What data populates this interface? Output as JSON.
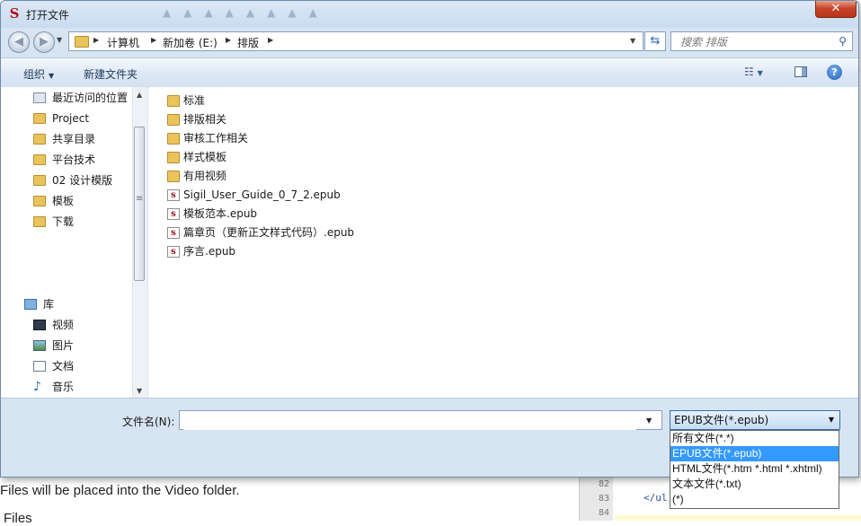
{
  "window": {
    "title": "打开文件",
    "close_label": "✕"
  },
  "nav": {
    "back_icon": "◀",
    "forward_icon": "▶",
    "breadcrumb": [
      "计算机",
      "新加卷 (E:)",
      "排版"
    ],
    "search_placeholder": "搜索 排版"
  },
  "toolbar": {
    "organize_label": "组织",
    "new_folder_label": "新建文件夹"
  },
  "sidebar": {
    "favorites": [
      {
        "label": "最近访问的位置",
        "icon": "recent-places-icon"
      },
      {
        "label": "Project",
        "icon": "folder-icon"
      },
      {
        "label": "共享目录",
        "icon": "folder-icon"
      },
      {
        "label": "平台技术",
        "icon": "folder-icon"
      },
      {
        "label": "02 设计模版",
        "icon": "folder-icon"
      },
      {
        "label": "模板",
        "icon": "folder-icon"
      },
      {
        "label": "下载",
        "icon": "folder-icon"
      }
    ],
    "library_label": "库",
    "library_items": [
      {
        "label": "视频",
        "icon": "video-library-icon"
      },
      {
        "label": "图片",
        "icon": "picture-library-icon"
      },
      {
        "label": "文档",
        "icon": "document-library-icon"
      },
      {
        "label": "音乐",
        "icon": "music-library-icon"
      }
    ]
  },
  "files": [
    {
      "name": "标准",
      "type": "folder"
    },
    {
      "name": "排版相关",
      "type": "folder"
    },
    {
      "name": "审核工作相关",
      "type": "folder"
    },
    {
      "name": "样式模板",
      "type": "folder"
    },
    {
      "name": "有用视频",
      "type": "folder"
    },
    {
      "name": "Sigil_User_Guide_0_7_2.epub",
      "type": "epub"
    },
    {
      "name": "模板范本.epub",
      "type": "epub"
    },
    {
      "name": "篇章页（更新正文样式代码）.epub",
      "type": "epub"
    },
    {
      "name": "序言.epub",
      "type": "epub"
    }
  ],
  "footer": {
    "filename_label": "文件名(N):",
    "filename_value": "",
    "filetype_selected": "EPUB文件(*.epub)",
    "filetype_options": [
      "所有文件(*.*)",
      "EPUB文件(*.epub)",
      "HTML文件(*.htm *.html *.xhtml)",
      "文本文件(*.txt)",
      "(*)"
    ],
    "filetype_selected_index": 1
  },
  "background": {
    "text_line1": "Files will be placed into the Video folder.",
    "text_line2": "Files",
    "gutter_lines": [
      "82",
      "83",
      "84"
    ],
    "code_line": "</ul"
  }
}
